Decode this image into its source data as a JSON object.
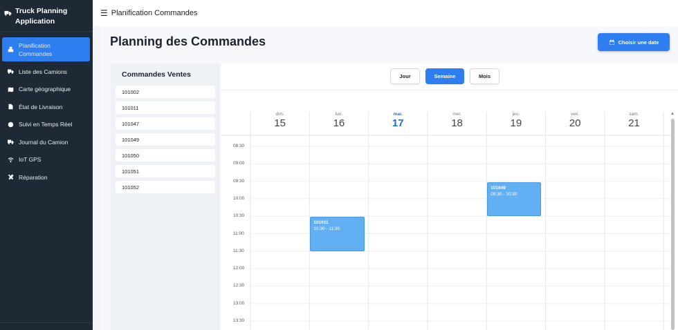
{
  "app": {
    "title": "Truck Planning Application"
  },
  "sidebar": {
    "items": [
      {
        "label": "Planification Commandes",
        "icon": "boxes-icon",
        "active": true
      },
      {
        "label": "Liste des Camions",
        "icon": "truck-icon"
      },
      {
        "label": "Carte géographique",
        "icon": "map-icon"
      },
      {
        "label": "État de Livraison",
        "icon": "file-icon"
      },
      {
        "label": "Suivi en Temps Réel",
        "icon": "clock-icon"
      },
      {
        "label": "Journal du Camion",
        "icon": "truck-icon"
      },
      {
        "label": "IoT GPS",
        "icon": "wifi-icon"
      },
      {
        "label": "Réparation",
        "icon": "tools-icon"
      }
    ]
  },
  "topbar": {
    "title": "Planification Commandes"
  },
  "page": {
    "title": "Planning des Commandes",
    "date_button": "Choisir une date"
  },
  "orders": {
    "title": "Commandes Ventes",
    "items": [
      "101002",
      "101011",
      "101047",
      "101049",
      "101050",
      "101051",
      "101052"
    ]
  },
  "calendar": {
    "views": [
      "Jour",
      "Semaine",
      "Mois"
    ],
    "active_view": "Semaine",
    "days": [
      {
        "name": "dim.",
        "date": "15"
      },
      {
        "name": "lun.",
        "date": "16"
      },
      {
        "name": "mar.",
        "date": "17",
        "today": true
      },
      {
        "name": "mer.",
        "date": "18"
      },
      {
        "name": "jeu.",
        "date": "19"
      },
      {
        "name": "ven.",
        "date": "20"
      },
      {
        "name": "sam.",
        "date": "21"
      }
    ],
    "times": [
      "08:30",
      "09:00",
      "09:30",
      "10:00",
      "10:30",
      "11:00",
      "11:30",
      "12:00",
      "12:30",
      "13:00",
      "13:30"
    ],
    "events": [
      {
        "id": "101049",
        "time": "09:30 - 10:30",
        "day": 4,
        "start": 2,
        "slots": 2
      },
      {
        "id": "101011",
        "time": "10:30 - 11:30",
        "day": 1,
        "start": 4,
        "slots": 2
      }
    ],
    "accent": "#2d7ff1",
    "event_color": "#62b0f3"
  }
}
